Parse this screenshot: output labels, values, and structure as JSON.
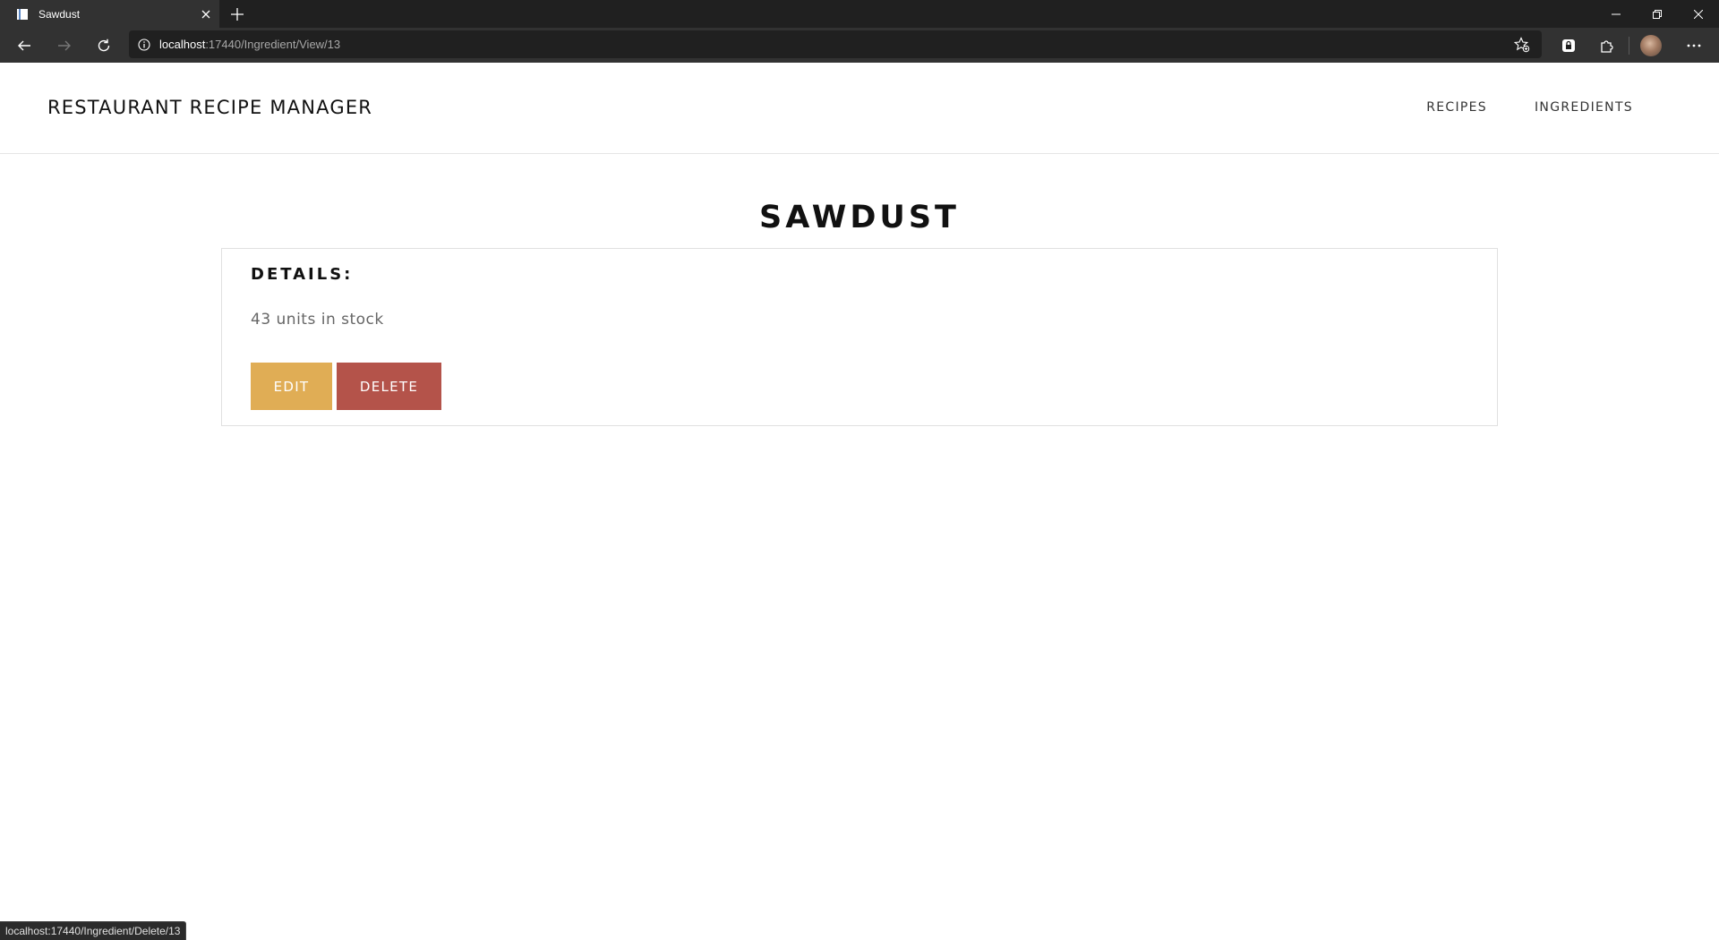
{
  "browser": {
    "tab_title": "Sawdust",
    "address": {
      "host": "localhost",
      "path": ":17440/Ingredient/View/13"
    },
    "status_url": "localhost:17440/Ingredient/Delete/13"
  },
  "header": {
    "brand": "RESTAURANT RECIPE MANAGER",
    "nav": {
      "recipes": "RECIPES",
      "ingredients": "INGREDIENTS"
    }
  },
  "ingredient": {
    "title": "SAWDUST",
    "details_heading": "DETAILS:",
    "stock_text": "43 units in stock",
    "edit_label": "EDIT",
    "delete_label": "DELETE"
  },
  "colors": {
    "edit_button": "#e0ad55",
    "delete_button": "#b4534a"
  },
  "icons": {
    "tab": "page-icon",
    "back": "arrow-left-icon",
    "forward": "arrow-right-icon",
    "refresh": "refresh-icon",
    "info": "info-icon",
    "favorites": "star-add-icon",
    "lock_extension": "lock-icon",
    "extensions": "puzzle-icon",
    "menu": "more-icon"
  }
}
